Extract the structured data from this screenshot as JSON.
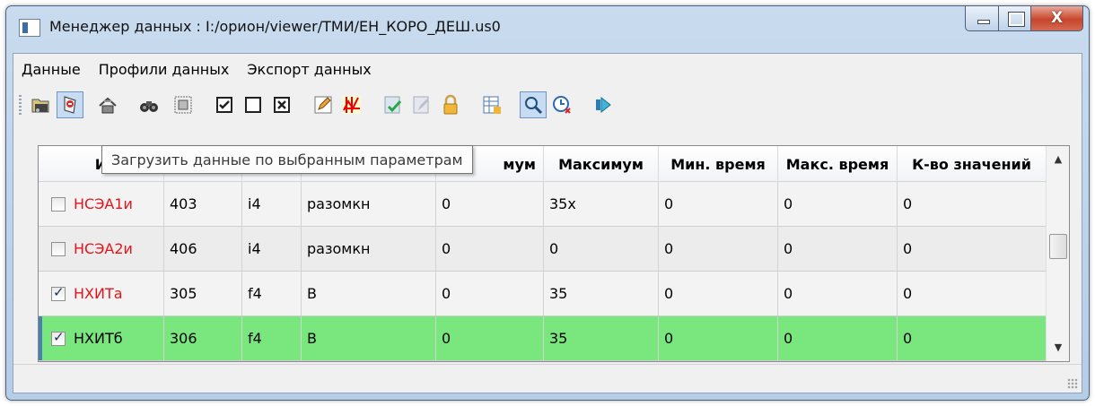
{
  "window": {
    "title": "Менеджер данных : I:/орион/viewer/ТМИ/ЕН_КОРО_ДЕШ.us0",
    "close_glyph": "X"
  },
  "menu": [
    "Данные",
    "Профили данных",
    "Экспорт данных"
  ],
  "toolbar": [
    {
      "icon": "open-folder-icon",
      "pressed": false
    },
    {
      "icon": "load-data-icon",
      "pressed": true
    },
    {
      "icon": "profile-icon",
      "pressed": false
    },
    {
      "icon": "binoculars-icon",
      "pressed": false
    },
    {
      "icon": "filter-grid-icon",
      "pressed": false
    },
    {
      "icon": "check-all-icon",
      "pressed": false
    },
    {
      "icon": "uncheck-all-icon",
      "pressed": false
    },
    {
      "icon": "invert-check-icon",
      "pressed": false
    },
    {
      "icon": "edit-icon",
      "pressed": false
    },
    {
      "icon": "chart-icon",
      "pressed": false
    },
    {
      "icon": "approve-icon",
      "pressed": false
    },
    {
      "icon": "edit-disabled-icon",
      "pressed": false
    },
    {
      "icon": "lock-icon",
      "pressed": false
    },
    {
      "icon": "table-export-icon",
      "pressed": false
    },
    {
      "icon": "zoom-search-icon",
      "pressed": true
    },
    {
      "icon": "time-clear-icon",
      "pressed": false
    },
    {
      "icon": "next-arrow-icon",
      "pressed": false
    }
  ],
  "table": {
    "headers": [
      "И",
      "",
      "",
      "",
      "мум",
      "Максимум",
      "Мин. время",
      "Макс. время",
      "К-во значений"
    ],
    "rows": [
      {
        "checked": false,
        "name": "НСЭА1и",
        "id": "403",
        "type": "i4",
        "unit": "разомкн",
        "min": "0",
        "max": "35x",
        "tmin": "0",
        "tmax": "0",
        "count": "0",
        "style": "red"
      },
      {
        "checked": false,
        "name": "НСЭА2и",
        "id": "406",
        "type": "i4",
        "unit": "разомкн",
        "min": "0",
        "max": "0",
        "tmin": "0",
        "tmax": "0",
        "count": "0",
        "style": "red"
      },
      {
        "checked": true,
        "name": "НХИТа",
        "id": "305",
        "type": "f4",
        "unit": "В",
        "min": "0",
        "max": "35",
        "tmin": "0",
        "tmax": "0",
        "count": "0",
        "style": "red"
      },
      {
        "checked": true,
        "name": "НХИТб",
        "id": "306",
        "type": "f4",
        "unit": "В",
        "min": "0",
        "max": "35",
        "tmin": "0",
        "tmax": "0",
        "count": "0",
        "style": "selected"
      }
    ]
  },
  "tooltip": "Загрузить данные по выбранным параметрам",
  "colors": {
    "selected_row": "#79e77d",
    "alert_text": "#e4151c"
  }
}
